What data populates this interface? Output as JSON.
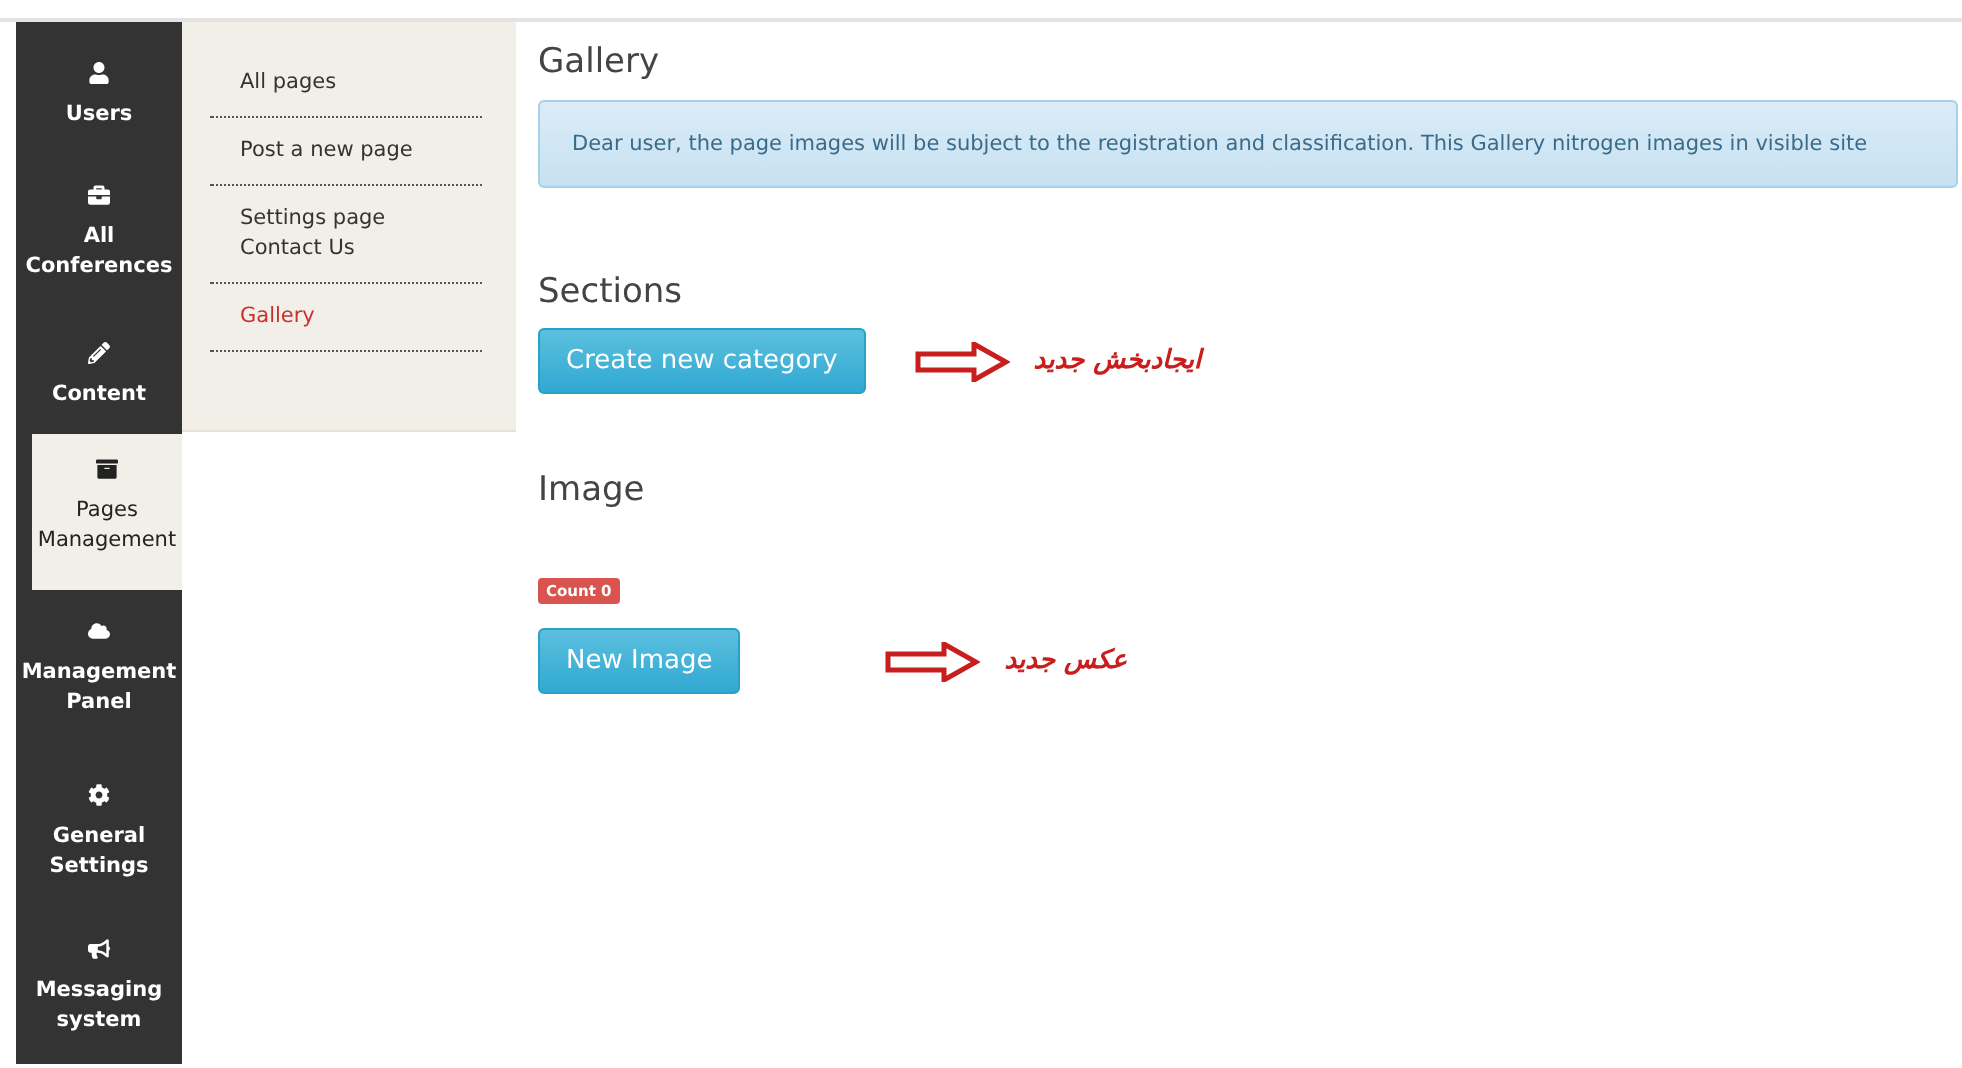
{
  "sidebar": {
    "items": [
      {
        "label": "Users",
        "selected": false
      },
      {
        "label": "All Conferences",
        "selected": false
      },
      {
        "label": "Content",
        "selected": false
      },
      {
        "label": "Pages Management",
        "selected": true
      },
      {
        "label": "Management Panel",
        "selected": false
      },
      {
        "label": "General Settings",
        "selected": false
      },
      {
        "label": "Messaging system",
        "selected": false
      }
    ]
  },
  "submenu": {
    "items": [
      {
        "label": "All pages",
        "selected": false
      },
      {
        "label": "Post a new page",
        "selected": false
      },
      {
        "label": "Settings page Contact Us",
        "selected": false
      },
      {
        "label": "Gallery",
        "selected": true
      }
    ]
  },
  "page": {
    "title": "Gallery",
    "notice": "Dear user, the page images will be subject to the registration and classification. This  Gallery nitrogen images in visible site",
    "sections": [
      {
        "heading": "Sections",
        "button": "Create new category",
        "annotation": "ایجادبخش جدید"
      },
      {
        "heading": "Image",
        "badge": "Count 0",
        "button": "New Image",
        "annotation": "عکس جدید"
      }
    ]
  }
}
